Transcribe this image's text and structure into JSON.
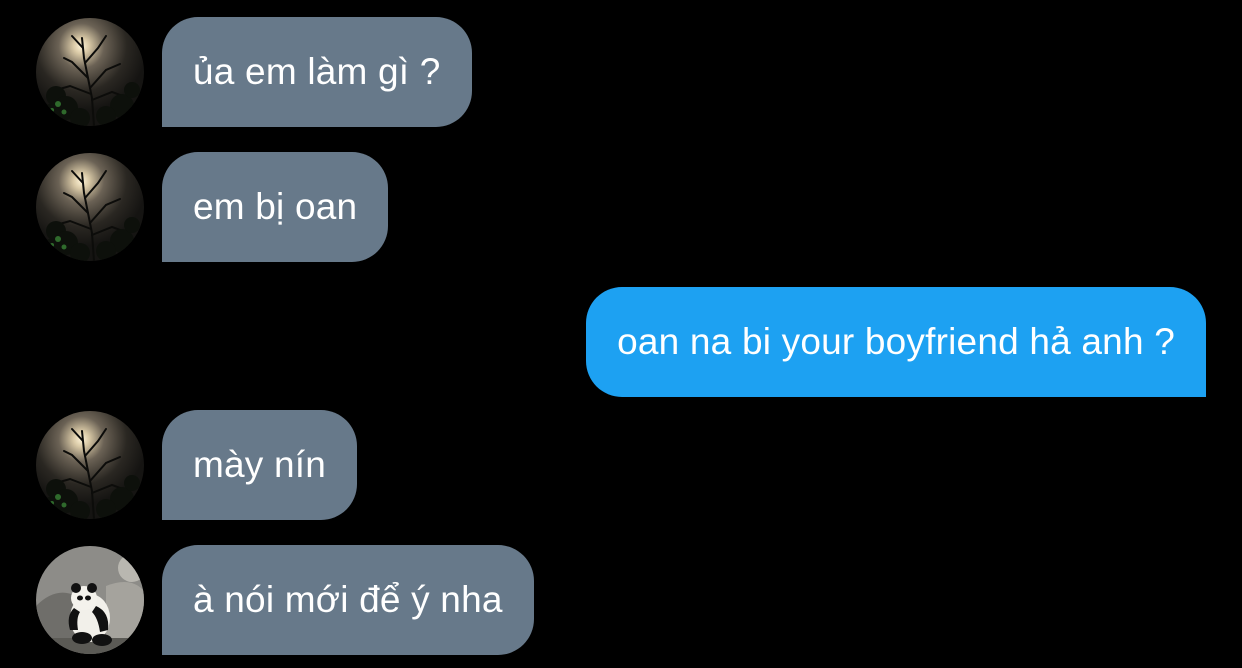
{
  "conversation": {
    "messages": [
      {
        "direction": "incoming",
        "avatar": "night-tree-moon",
        "text": "ủa em làm gì ?"
      },
      {
        "direction": "incoming",
        "avatar": "night-tree-moon",
        "text": "em bị oan"
      },
      {
        "direction": "outgoing",
        "text": "oan na bi your boyfriend hả anh ?"
      },
      {
        "direction": "incoming",
        "avatar": "night-tree-moon",
        "text": "mày nín"
      },
      {
        "direction": "incoming",
        "avatar": "panda",
        "text": "à nói mới để ý nha"
      }
    ]
  },
  "colors": {
    "background": "#000000",
    "incoming_bubble": "#67798a",
    "outgoing_bubble": "#1da1f2",
    "text": "#ffffff"
  }
}
